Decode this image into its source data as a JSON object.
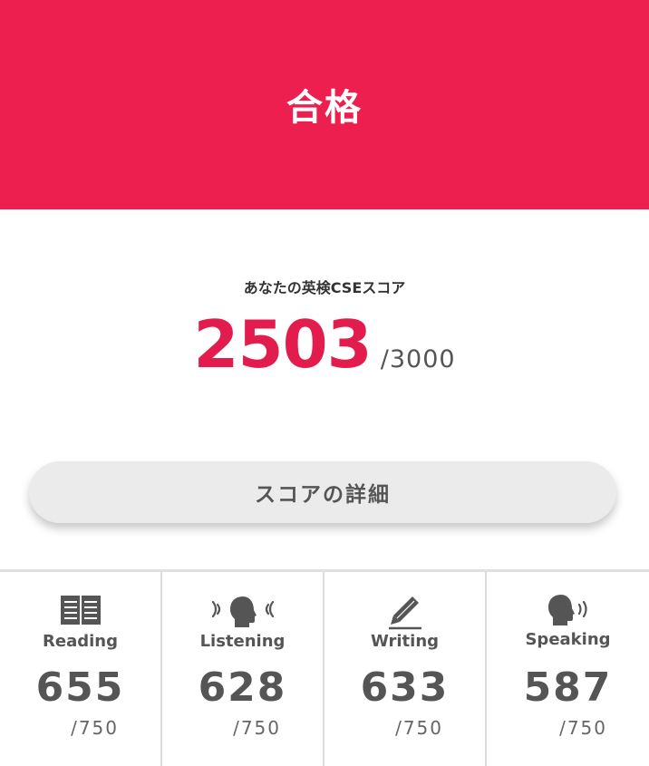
{
  "banner": {
    "title": "合格"
  },
  "score": {
    "label": "あなたの英検CSEスコア",
    "value": "2503",
    "max": "/3000"
  },
  "detail_button": {
    "label": "スコアの詳細"
  },
  "skills": [
    {
      "name": "Reading",
      "score": "655",
      "max": "/750",
      "icon": "book-icon"
    },
    {
      "name": "Listening",
      "score": "628",
      "max": "/750",
      "icon": "listening-head-icon"
    },
    {
      "name": "Writing",
      "score": "633",
      "max": "/750",
      "icon": "pencil-icon"
    },
    {
      "name": "Speaking",
      "score": "587",
      "max": "/750",
      "icon": "speaking-head-icon"
    }
  ],
  "colors": {
    "brand": "#ec1f4f",
    "score": "#e31c4e",
    "text_gray": "#555555",
    "button_bg": "#ebebeb"
  }
}
